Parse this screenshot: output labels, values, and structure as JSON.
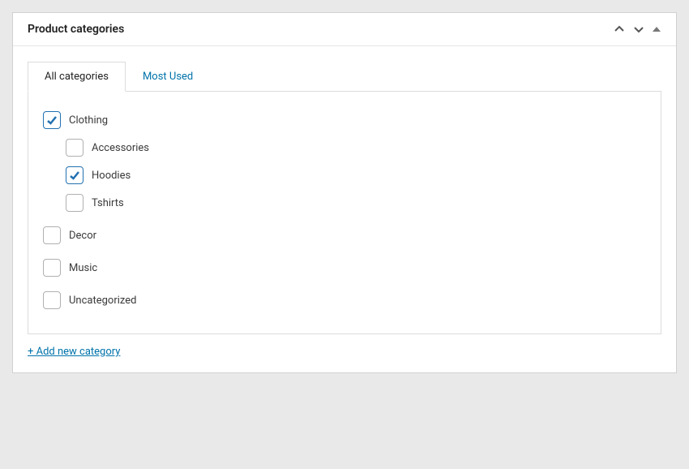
{
  "panel": {
    "title": "Product categories"
  },
  "tabs": {
    "all": "All categories",
    "most_used": "Most Used"
  },
  "categories": [
    {
      "label": "Clothing",
      "checked": true,
      "children": [
        {
          "label": "Accessories",
          "checked": false
        },
        {
          "label": "Hoodies",
          "checked": true
        },
        {
          "label": "Tshirts",
          "checked": false
        }
      ]
    },
    {
      "label": "Decor",
      "checked": false
    },
    {
      "label": "Music",
      "checked": false
    },
    {
      "label": "Uncategorized",
      "checked": false
    }
  ],
  "add_link": "+ Add new category"
}
